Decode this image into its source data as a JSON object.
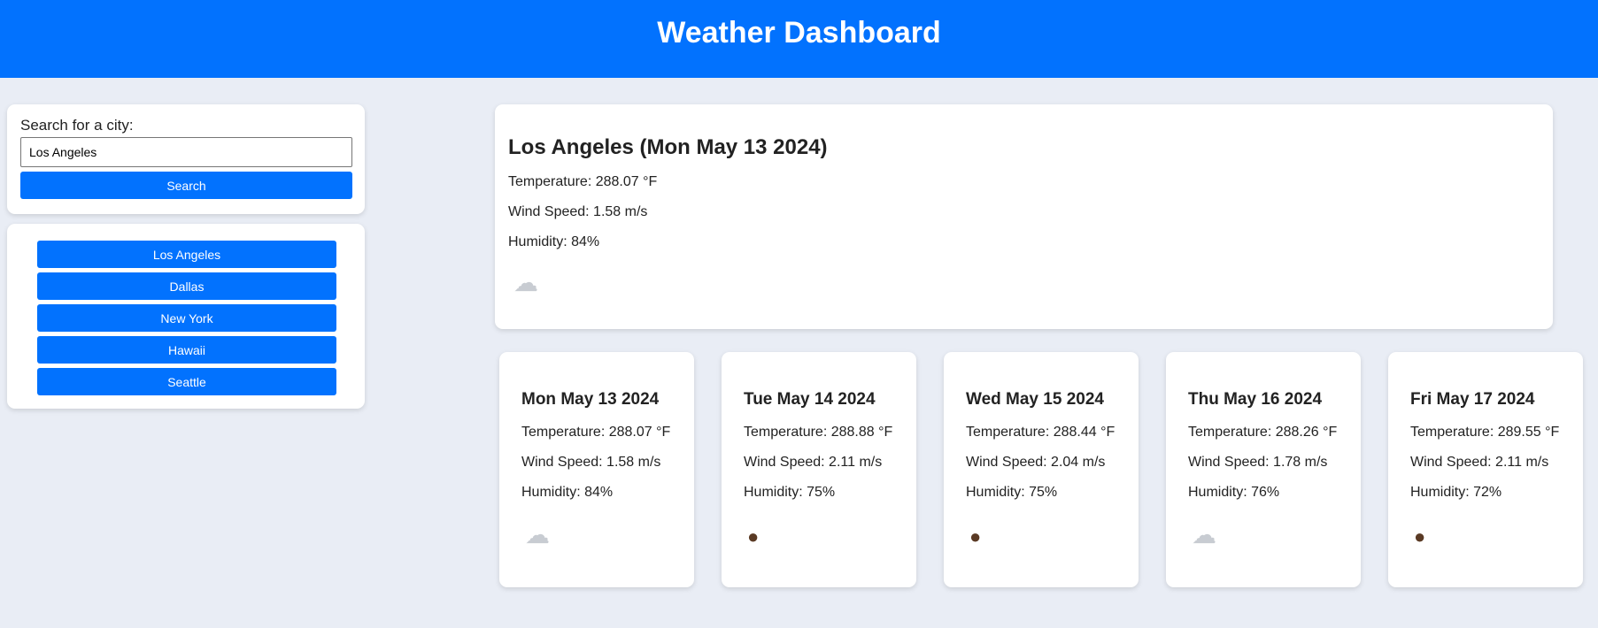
{
  "header": {
    "title": "Weather Dashboard"
  },
  "search": {
    "label": "Search for a city:",
    "value": "Los Angeles",
    "button_label": "Search"
  },
  "history": [
    {
      "label": "Los Angeles"
    },
    {
      "label": "Dallas"
    },
    {
      "label": "New York"
    },
    {
      "label": "Hawaii"
    },
    {
      "label": "Seattle"
    }
  ],
  "current": {
    "title": "Los Angeles (Mon May 13 2024)",
    "temperature": "Temperature: 288.07 °F",
    "wind": "Wind Speed: 1.58 m/s",
    "humidity": "Humidity: 84%",
    "icon": "partly-cloudy-icon"
  },
  "forecast": [
    {
      "date": "Mon May 13 2024",
      "temperature": "Temperature: 288.07 °F",
      "wind": "Wind Speed: 1.58 m/s",
      "humidity": "Humidity: 84%",
      "icon": "partly-cloudy-icon"
    },
    {
      "date": "Tue May 14 2024",
      "temperature": "Temperature: 288.88 °F",
      "wind": "Wind Speed: 2.11 m/s",
      "humidity": "Humidity: 75%",
      "icon": "rain-icon"
    },
    {
      "date": "Wed May 15 2024",
      "temperature": "Temperature: 288.44 °F",
      "wind": "Wind Speed: 2.04 m/s",
      "humidity": "Humidity: 75%",
      "icon": "rain-icon"
    },
    {
      "date": "Thu May 16 2024",
      "temperature": "Temperature: 288.26 °F",
      "wind": "Wind Speed: 1.78 m/s",
      "humidity": "Humidity: 76%",
      "icon": "cloud-icon"
    },
    {
      "date": "Fri May 17 2024",
      "temperature": "Temperature: 289.55 °F",
      "wind": "Wind Speed: 2.11 m/s",
      "humidity": "Humidity: 72%",
      "icon": "rain-icon"
    }
  ],
  "colors": {
    "accent": "#0272fe",
    "background": "#e9edf5",
    "card": "#ffffff"
  }
}
